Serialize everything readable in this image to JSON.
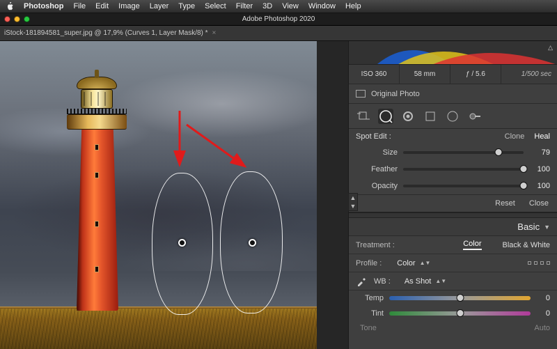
{
  "app": {
    "name": "Photoshop",
    "window_title": "Adobe Photoshop 2020",
    "menus": [
      "File",
      "Edit",
      "Image",
      "Layer",
      "Type",
      "Select",
      "Filter",
      "3D",
      "View",
      "Window",
      "Help"
    ]
  },
  "document": {
    "tab_label": "iStock-181894581_super.jpg @ 17,9% (Curves 1, Layer Mask/8) *"
  },
  "camera": {
    "iso": "ISO 360",
    "focal": "58 mm",
    "aperture": "ƒ / 5.6",
    "shutter": "1/500 sec",
    "original_photo": "Original Photo"
  },
  "spot_edit": {
    "title": "Spot Edit :",
    "mode_clone": "Clone",
    "mode_heal": "Heal",
    "size_label": "Size",
    "size_value": "79",
    "feather_label": "Feather",
    "feather_value": "100",
    "opacity_label": "Opacity",
    "opacity_value": "100",
    "reset": "Reset",
    "close": "Close"
  },
  "basic": {
    "title": "Basic",
    "treatment_label": "Treatment :",
    "color": "Color",
    "bw": "Black & White",
    "profile_label": "Profile :",
    "profile_value": "Color",
    "wb_label": "WB :",
    "wb_value": "As Shot",
    "temp_label": "Temp",
    "temp_value": "0",
    "tint_label": "Tint",
    "tint_value": "0",
    "tone_label": "Tone",
    "auto": "Auto"
  }
}
